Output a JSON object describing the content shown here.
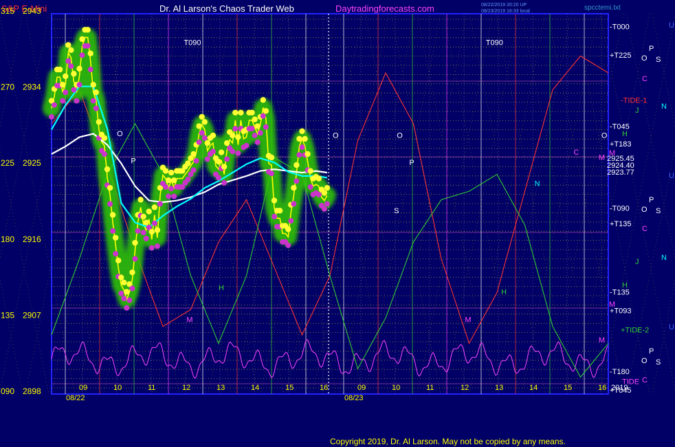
{
  "header": {
    "instrument": "S&P E-Mini",
    "title": "Dr. Al Larson's Chaos Trader Web",
    "site": "Daytradingforecasts.com",
    "stamp1": "08/22/2019 20:20 UP",
    "stamp2": "08/23/2019 16:33 local",
    "file": "spcctemi.txt"
  },
  "footer": {
    "copyright": "Copyright 2019, Dr. Al Larson. May not be copied by any means."
  },
  "colors": {
    "background": "#000066",
    "frame": "#2222ff",
    "price": "#ffff00",
    "ema_fast": "#00ffff",
    "ema_slow": "#ffffff",
    "tide": "#ff3333",
    "tide2": "#33cc33",
    "cycle": "#ff44ff"
  },
  "chart_data": {
    "type": "line",
    "y_axis": {
      "angle_labels": [
        "315",
        "270",
        "225",
        "180",
        "135",
        "090"
      ],
      "price_labels": [
        "2943",
        "2934",
        "2925",
        "2916",
        "2907",
        "2898"
      ],
      "ylim": [
        2898,
        2943
      ]
    },
    "x_axis": {
      "hour_labels": [
        "09",
        "10",
        "11",
        "12",
        "13",
        "14",
        "15",
        "16",
        "09",
        "10",
        "11",
        "12",
        "13",
        "14",
        "15",
        "16"
      ],
      "date_labels": [
        "08/22",
        "08/23"
      ],
      "right_year": "2019"
    },
    "series": [
      {
        "key": "price",
        "x": [
          0,
          2,
          4,
          6,
          8,
          10,
          12,
          14,
          16,
          18,
          20,
          22,
          24,
          26,
          28,
          30,
          32,
          34,
          36,
          38,
          40,
          42,
          44,
          46,
          48,
          50,
          52,
          54,
          56,
          58,
          60,
          62,
          64,
          66,
          68,
          70,
          72,
          74,
          76,
          78,
          80,
          82,
          84,
          86,
          88,
          90,
          92,
          94,
          96,
          98,
          100,
          102,
          104,
          106,
          108,
          110,
          112,
          114,
          116,
          118,
          120,
          122,
          124,
          126,
          128,
          130,
          132,
          134,
          136,
          138,
          140,
          142,
          144,
          146,
          148,
          150,
          152,
          154,
          156,
          158,
          160,
          162,
          164,
          166,
          168,
          170,
          172,
          174,
          176,
          178,
          180,
          182,
          184,
          186,
          188,
          190,
          192,
          194,
          196,
          198
        ],
        "values": [
          2931.8,
          2933.2,
          2935.5,
          2935.5,
          2933.7,
          2934.7,
          2938.4,
          2937.8,
          2935,
          2933.7,
          2935.6,
          2939.1,
          2940.2,
          2940.2,
          2937.4,
          2933.7,
          2932.8,
          2929.3,
          2927.8,
          2927.4,
          2923.7,
          2921.5,
          2918.3,
          2915.6,
          2912.9,
          2910.9,
          2910.3,
          2909.2,
          2910.1,
          2911.5,
          2915,
          2918.3,
          2920.1,
          2918.1,
          2917.4,
          2918.7,
          2916.3,
          2919.2,
          2916.5,
          2921.5,
          2923.9,
          2923.5,
          2922.4,
          2923.3,
          2922.4,
          2923.5,
          2923.5,
          2923.5,
          2924,
          2924.4,
          2925,
          2925.5,
          2926.6,
          2928.8,
          2929.9,
          2929.3,
          2926.8,
          2927.4,
          2927.7,
          2925,
          2924.6,
          2925.7,
          2924,
          2926.8,
          2928.1,
          2927.7,
          2930.4,
          2927.5,
          2930.4,
          2928.2,
          2928.4,
          2930.4,
          2930.4,
          2929.6,
          2928.8,
          2929.9,
          2931.9,
          2930.6,
          2925.3,
          2925.1,
          2920,
          2918.8,
          2918.8,
          2917,
          2917,
          2916.6,
          2919.5,
          2921.5,
          2924.2,
          2927.3,
          2928.2,
          2927.3,
          2925.5,
          2923.5,
          2922.6,
          2922.8,
          2922.6,
          2921.3,
          2920.9,
          2921.5
        ]
      },
      {
        "key": "ema_fast",
        "x": [
          0,
          10,
          20,
          30,
          40,
          50,
          60,
          70,
          80,
          90,
          100,
          110,
          120,
          130,
          140,
          150,
          160,
          170,
          180,
          190,
          198
        ],
        "values": [
          2929.3,
          2932.2,
          2934.4,
          2934.4,
          2929.4,
          2920.6,
          2918.3,
          2917.7,
          2919.1,
          2920.2,
          2921.1,
          2922.4,
          2923.2,
          2924.2,
          2925.2,
          2925.9,
          2925.4,
          2924.3,
          2923.8,
          2923.8,
          2923.6
        ]
      },
      {
        "key": "ema_slow",
        "x": [
          0,
          10,
          20,
          30,
          40,
          50,
          60,
          70,
          80,
          90,
          100,
          110,
          120,
          130,
          140,
          150,
          160,
          170,
          180,
          190,
          198
        ],
        "values": [
          2926.4,
          2927.3,
          2928.4,
          2928.8,
          2927.5,
          2925.3,
          2922.6,
          2920.9,
          2920.7,
          2920.9,
          2921.3,
          2921.9,
          2922.8,
          2923.3,
          2923.8,
          2924.4,
          2924.6,
          2924.4,
          2924.2,
          2924.4,
          2924.2
        ]
      },
      {
        "key": "tide",
        "x": [
          0,
          20,
          40,
          60,
          80,
          100,
          120,
          140,
          160,
          180,
          200,
          220,
          240,
          260,
          280,
          300,
          320,
          340,
          360,
          380,
          400
        ],
        "values": [
          2930,
          2934,
          2925,
          2915,
          2906,
          2908,
          2916,
          2921,
          2913,
          2905,
          2912,
          2928,
          2936,
          2930,
          2914,
          2904,
          2910,
          2922,
          2934,
          2938,
          2936
        ]
      },
      {
        "key": "tide2",
        "x": [
          0,
          20,
          40,
          60,
          80,
          100,
          120,
          140,
          160,
          180,
          200,
          220,
          240,
          260,
          280,
          300,
          320,
          340,
          360,
          380,
          400
        ],
        "values": [
          2905,
          2914,
          2924,
          2930,
          2924,
          2912,
          2904,
          2912,
          2926,
          2924,
          2912,
          2901,
          2907,
          2916,
          2921,
          2922,
          2924,
          2918,
          2906,
          2900,
          2904
        ]
      }
    ],
    "price_callouts": [
      "2925.45",
      "2924.40",
      "2923.77"
    ],
    "right_labels": [
      {
        "text": "-T000",
        "price": 2941.5
      },
      {
        "text": "+T225",
        "price": 2938.1
      },
      {
        "text": "-T045",
        "price": 2929.7
      },
      {
        "text": "+T183",
        "price": 2927.6
      },
      {
        "text": "-T090",
        "price": 2920.0
      },
      {
        "text": "+T135",
        "price": 2918.2
      },
      {
        "text": "-T135",
        "price": 2910.1
      },
      {
        "text": "+T093",
        "price": 2907.9
      },
      {
        "text": "+TIDE-2",
        "price": 2905.6
      },
      {
        "text": "-T180",
        "price": 2900.7
      },
      {
        "text": "+T045",
        "price": 2898.5
      },
      {
        "text": "-TIDE-1",
        "price": 2932.8
      },
      {
        "text": "TIDE",
        "price": 2899.5
      }
    ],
    "chart_letters": [
      {
        "text": "T090",
        "x": 95,
        "price": 2939.3
      },
      {
        "text": "T090",
        "x": 312,
        "price": 2939.3
      },
      {
        "text": "O",
        "x": 47,
        "price": 2928.5
      },
      {
        "text": "O",
        "x": 202,
        "price": 2928.3
      },
      {
        "text": "O",
        "x": 248,
        "price": 2928.3
      },
      {
        "text": "O",
        "x": 395,
        "price": 2928.3
      },
      {
        "text": "P",
        "x": 57,
        "price": 2925.3
      },
      {
        "text": "P",
        "x": 257,
        "price": 2925.1
      },
      {
        "text": "S",
        "x": 246,
        "price": 2919.4
      },
      {
        "text": "H",
        "x": 120,
        "price": 2910.3
      },
      {
        "text": "H",
        "x": 323,
        "price": 2909.8
      },
      {
        "text": "M",
        "x": 97,
        "price": 2906.5
      },
      {
        "text": "M",
        "x": 297,
        "price": 2906.5
      },
      {
        "text": "M",
        "x": 393,
        "price": 2904.1
      },
      {
        "text": "N",
        "x": 347,
        "price": 2922.6
      },
      {
        "text": "C",
        "x": 375,
        "price": 2926.3
      },
      {
        "text": "M",
        "x": 393,
        "price": 2925.7
      }
    ],
    "side_glyphs": [
      {
        "text": "U",
        "x": 973,
        "y": 40,
        "color": "#4466ff"
      },
      {
        "text": "P",
        "x": 944,
        "y": 74,
        "color": "#ffffff"
      },
      {
        "text": "O",
        "x": 933,
        "y": 88,
        "color": "#ffffff"
      },
      {
        "text": "S",
        "x": 954,
        "y": 90,
        "color": "#ffffff"
      },
      {
        "text": "C",
        "x": 934,
        "y": 118,
        "color": "#ff44ff"
      },
      {
        "text": "N",
        "x": 962,
        "y": 158,
        "color": "#00ffff"
      },
      {
        "text": "J",
        "x": 924,
        "y": 164,
        "color": "#33cc33"
      },
      {
        "text": "H",
        "x": 905,
        "y": 198,
        "color": "#33cc33"
      },
      {
        "text": "M",
        "x": 886,
        "y": 226,
        "color": "#ff44ff"
      },
      {
        "text": "U",
        "x": 973,
        "y": 259,
        "color": "#4466ff"
      },
      {
        "text": "P",
        "x": 944,
        "y": 294,
        "color": "#ffffff"
      },
      {
        "text": "O",
        "x": 933,
        "y": 308,
        "color": "#ffffff"
      },
      {
        "text": "S",
        "x": 954,
        "y": 310,
        "color": "#ffffff"
      },
      {
        "text": "C",
        "x": 934,
        "y": 336,
        "color": "#ff44ff"
      },
      {
        "text": "N",
        "x": 962,
        "y": 378,
        "color": "#00ffff"
      },
      {
        "text": "J",
        "x": 924,
        "y": 384,
        "color": "#33cc33"
      },
      {
        "text": "H",
        "x": 905,
        "y": 418,
        "color": "#33cc33"
      },
      {
        "text": "M",
        "x": 886,
        "y": 446,
        "color": "#ff44ff"
      },
      {
        "text": "U",
        "x": 973,
        "y": 479,
        "color": "#4466ff"
      },
      {
        "text": "P",
        "x": 944,
        "y": 514,
        "color": "#ffffff"
      },
      {
        "text": "O",
        "x": 933,
        "y": 528,
        "color": "#ffffff"
      },
      {
        "text": "S",
        "x": 954,
        "y": 530,
        "color": "#ffffff"
      },
      {
        "text": "C",
        "x": 934,
        "y": 556,
        "color": "#ff44ff"
      }
    ],
    "grid": true
  }
}
